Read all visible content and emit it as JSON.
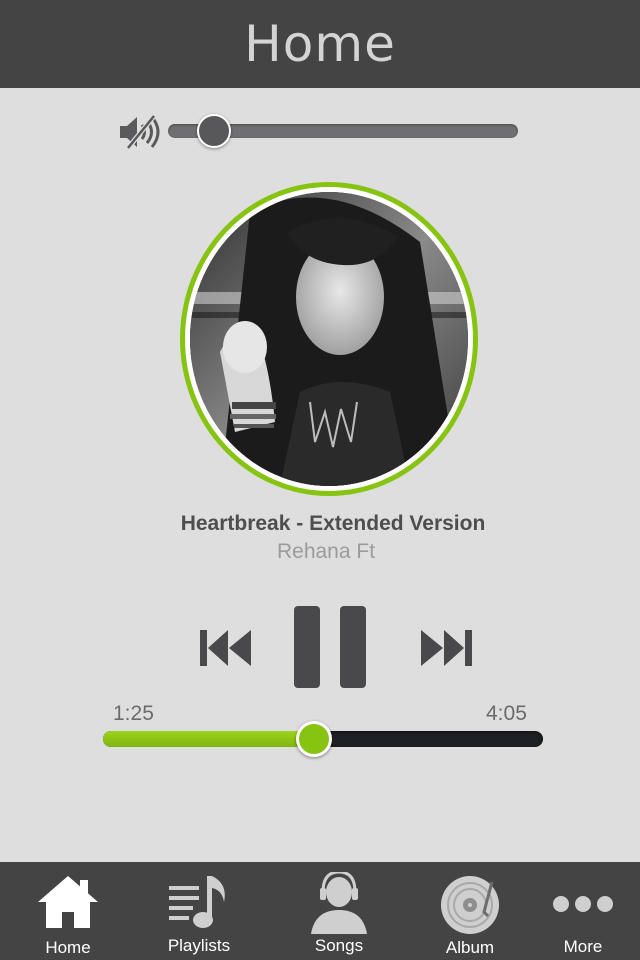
{
  "header": {
    "title": "Home"
  },
  "volume": {
    "level": 0.13,
    "muted": true,
    "icon": "speaker-muted-icon"
  },
  "now_playing": {
    "title": "Heartbreak - Extended Version",
    "artist": "Rehana Ft",
    "artwork_icon": "album-art-photo"
  },
  "controls": {
    "previous_icon": "skip-previous-icon",
    "pause_icon": "pause-icon",
    "next_icon": "skip-next-icon"
  },
  "progress": {
    "elapsed": "1:25",
    "total": "4:05",
    "fraction": 0.48
  },
  "tabs": [
    {
      "label": "Home",
      "icon": "home-icon",
      "active": true
    },
    {
      "label": "Playlists",
      "icon": "playlist-icon",
      "active": false
    },
    {
      "label": "Songs",
      "icon": "headset-person-icon",
      "active": false
    },
    {
      "label": "Album",
      "icon": "vinyl-record-icon",
      "active": false
    },
    {
      "label": "More",
      "icon": "more-dots-icon",
      "active": false
    }
  ],
  "colors": {
    "accent": "#86c411",
    "header_bg": "#454445",
    "page_bg": "#dedede",
    "track_dark": "#1f2023"
  }
}
